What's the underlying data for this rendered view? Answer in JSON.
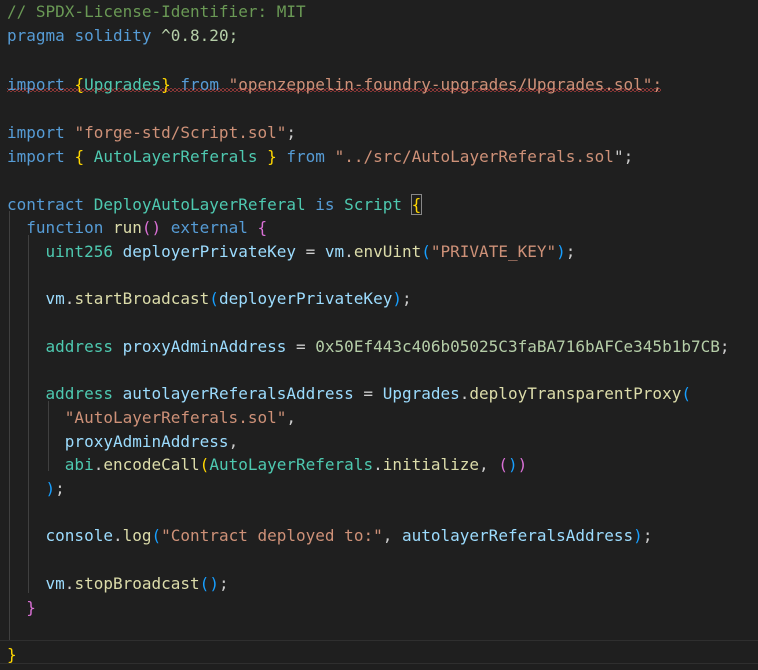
{
  "editor": {
    "language": "solidity",
    "lines": [
      "// SPDX-License-Identifier: MIT",
      "pragma solidity ^0.8.20;",
      "",
      "import {Upgrades} from \"openzeppelin-foundry-upgrades/Upgrades.sol\";",
      "",
      "import \"forge-std/Script.sol\";",
      "import { AutoLayerReferals } from \"../src/AutoLayerReferals.sol\";",
      "",
      "contract DeployAutoLayerReferal is Script {",
      "  function run() external {",
      "    uint256 deployerPrivateKey = vm.envUint(\"PRIVATE_KEY\");",
      "",
      "    vm.startBroadcast(deployerPrivateKey);",
      "",
      "    address proxyAdminAddress = 0x50Ef443c406b05025C3faBA716bAFCe345b1b7CB;",
      "",
      "    address autolayerReferalsAddress = Upgrades.deployTransparentProxy(",
      "      \"AutoLayerReferals.sol\",",
      "      proxyAdminAddress,",
      "      abi.encodeCall(AutoLayerReferals.initialize, ())",
      "    );",
      "",
      "    console.log(\"Contract deployed to:\", autolayerReferalsAddress);",
      "",
      "    vm.stopBroadcast();",
      "  }",
      "",
      "}"
    ]
  },
  "colors": {
    "background": "#1f1f1f",
    "comment": "#6a9955",
    "keyword": "#569cd6",
    "type": "#4ec9b0",
    "variable": "#9cdcfe",
    "function": "#dcdcaa",
    "string": "#ce9178",
    "number": "#b5cea8",
    "bracket_gold": "#ffd700",
    "bracket_purple": "#da70d6",
    "bracket_blue": "#179fff",
    "error_squiggle": "#f14c4c"
  }
}
